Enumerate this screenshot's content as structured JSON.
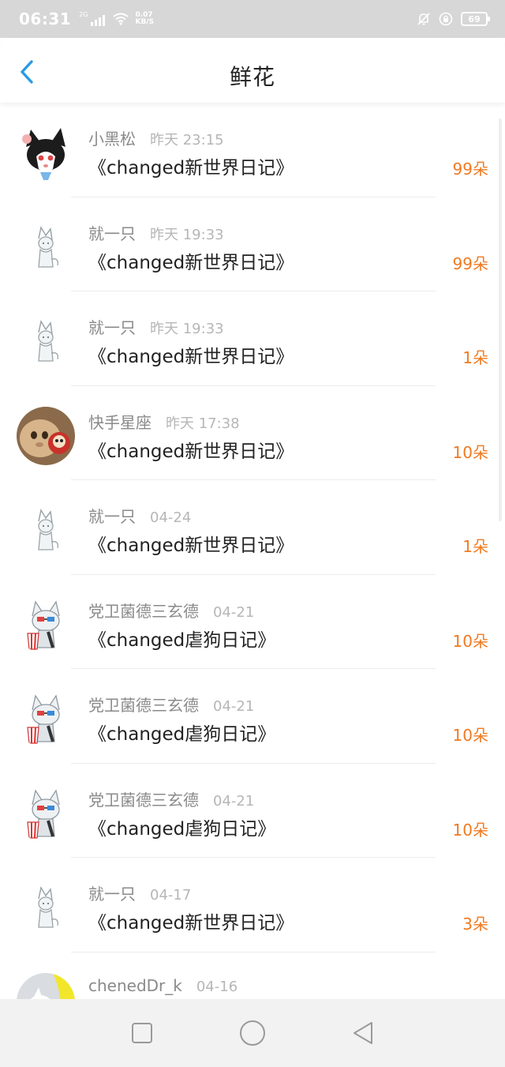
{
  "status_bar": {
    "time": "06:31",
    "network": "2G",
    "speed_value": "0.07",
    "speed_unit": "KB/S",
    "battery": "69"
  },
  "header": {
    "title": "鲜花",
    "back_icon": "chevron-left-icon"
  },
  "colors": {
    "accent": "#2b9ae6",
    "count": "#f07a20",
    "status_bar_bg": "#d7d7d7"
  },
  "items": [
    {
      "user": "小黑松",
      "time": "昨天 23:15",
      "title": "《changed新世界日记》",
      "count": "99朵",
      "avatar": "black-white-fox-avatar"
    },
    {
      "user": "就一只",
      "time": "昨天 19:33",
      "title": "《changed新世界日记》",
      "count": "99朵",
      "avatar": "white-sketch-wolf-avatar"
    },
    {
      "user": "就一只",
      "time": "昨天 19:33",
      "title": "《changed新世界日记》",
      "count": "1朵",
      "avatar": "white-sketch-wolf-avatar"
    },
    {
      "user": "快手星座",
      "time": "昨天 17:38",
      "title": "《changed新世界日记》",
      "count": "10朵",
      "avatar": "cat-photo-avatar"
    },
    {
      "user": "就一只",
      "time": "04-24",
      "title": "《changed新世界日记》",
      "count": "1朵",
      "avatar": "white-sketch-wolf-avatar"
    },
    {
      "user": "党卫菌德三玄德",
      "time": "04-21",
      "title": "《changed虐狗日记》",
      "count": "10朵",
      "avatar": "wolf-3d-glasses-popcorn-avatar"
    },
    {
      "user": "党卫菌德三玄德",
      "time": "04-21",
      "title": "《changed虐狗日记》",
      "count": "10朵",
      "avatar": "wolf-3d-glasses-popcorn-avatar"
    },
    {
      "user": "党卫菌德三玄德",
      "time": "04-21",
      "title": "《changed虐狗日记》",
      "count": "10朵",
      "avatar": "wolf-3d-glasses-popcorn-avatar"
    },
    {
      "user": "就一只",
      "time": "04-17",
      "title": "《changed新世界日记》",
      "count": "3朵",
      "avatar": "white-sketch-wolf-avatar"
    },
    {
      "user": "chenedDr_k",
      "time": "04-16",
      "title": "",
      "count": "",
      "avatar": "white-creature-yellow-avatar"
    }
  ],
  "nav": {
    "recent_icon": "square-icon",
    "home_icon": "circle-icon",
    "back_icon": "triangle-back-icon"
  }
}
